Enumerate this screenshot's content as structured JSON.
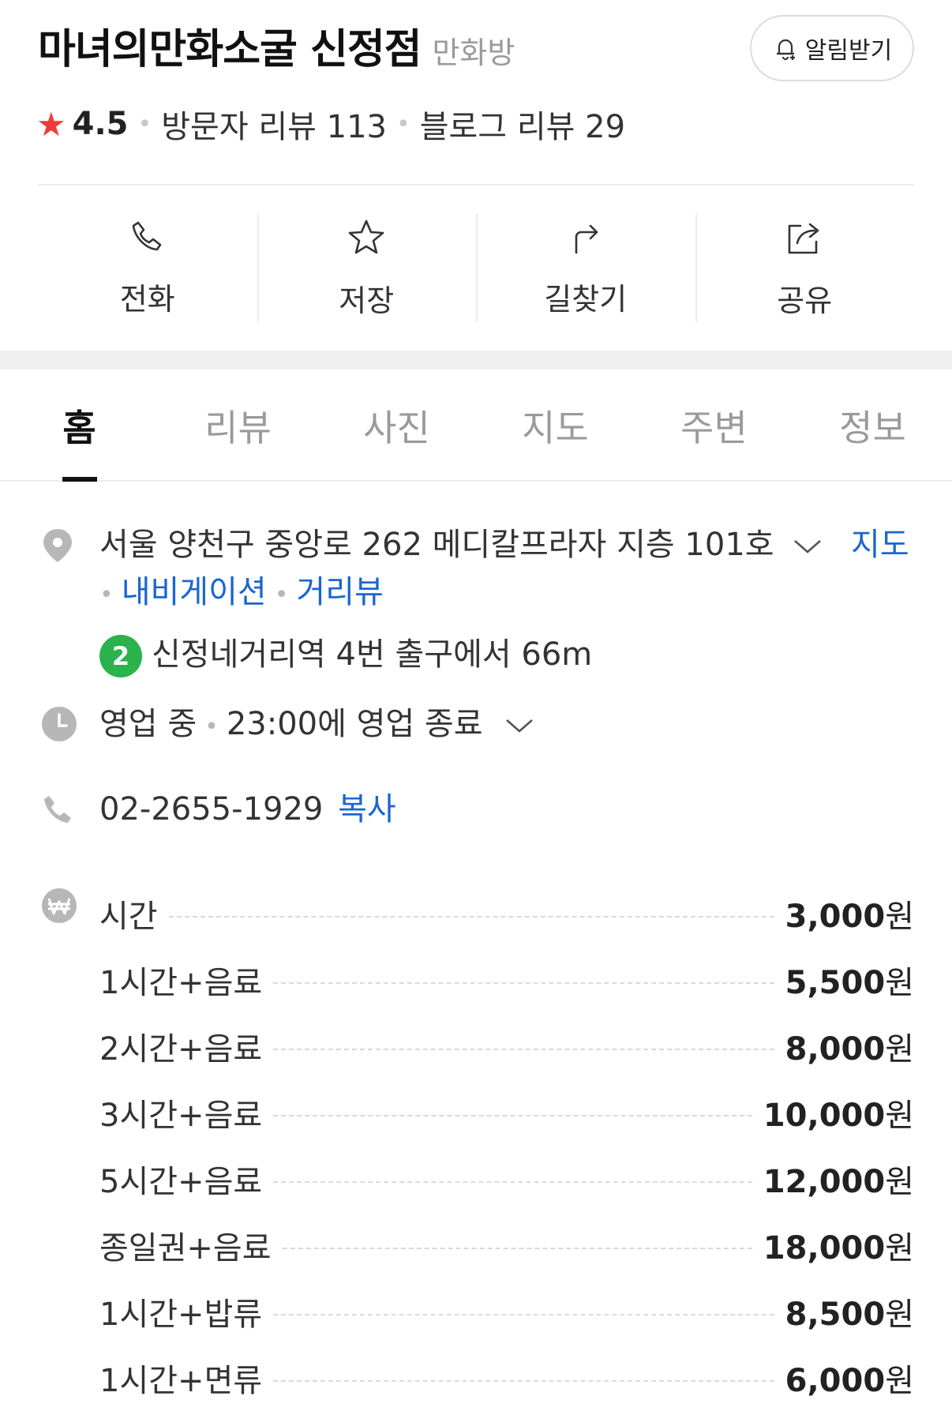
{
  "place": {
    "name": "마녀의만화소굴 신정점",
    "category": "만화방",
    "alarm_label": "알림받기",
    "rating": "4.5",
    "visitor_reviews": "방문자 리뷰 113",
    "blog_reviews": "블로그 리뷰 29"
  },
  "actions": [
    {
      "label": "전화",
      "icon": "phone-icon"
    },
    {
      "label": "저장",
      "icon": "star-outline-icon"
    },
    {
      "label": "길찾기",
      "icon": "directions-icon"
    },
    {
      "label": "공유",
      "icon": "share-icon"
    }
  ],
  "tabs": [
    "홈",
    "리뷰",
    "사진",
    "지도",
    "주변",
    "정보"
  ],
  "active_tab": "홈",
  "address": {
    "text": "서울 양천구 중앙로 262 메디칼프라자 지층 101호",
    "map_link": "지도",
    "navigation_link": "내비게이션",
    "street_view_link": "거리뷰",
    "subway_line": "2",
    "subway_line_color": "#2bb24c",
    "subway_text": "신정네거리역 4번 출구에서 66m"
  },
  "hours": {
    "status": "영업 중",
    "detail": "23:00에 영업 종료"
  },
  "phone": {
    "number": "02-2655-1929",
    "copy_label": "복사"
  },
  "prices": [
    {
      "name": "시간",
      "amount": "3,000",
      "unit": "원"
    },
    {
      "name": "1시간+음료",
      "amount": "5,500",
      "unit": "원"
    },
    {
      "name": "2시간+음료",
      "amount": "8,000",
      "unit": "원"
    },
    {
      "name": "3시간+음료",
      "amount": "10,000",
      "unit": "원"
    },
    {
      "name": "5시간+음료",
      "amount": "12,000",
      "unit": "원"
    },
    {
      "name": "종일권+음료",
      "amount": "18,000",
      "unit": "원"
    },
    {
      "name": "1시간+밥류",
      "amount": "8,500",
      "unit": "원"
    },
    {
      "name": "1시간+면류",
      "amount": "6,000",
      "unit": "원"
    }
  ],
  "colors": {
    "accent_link": "#1b66d0",
    "rating_star": "#ef3b3b"
  }
}
